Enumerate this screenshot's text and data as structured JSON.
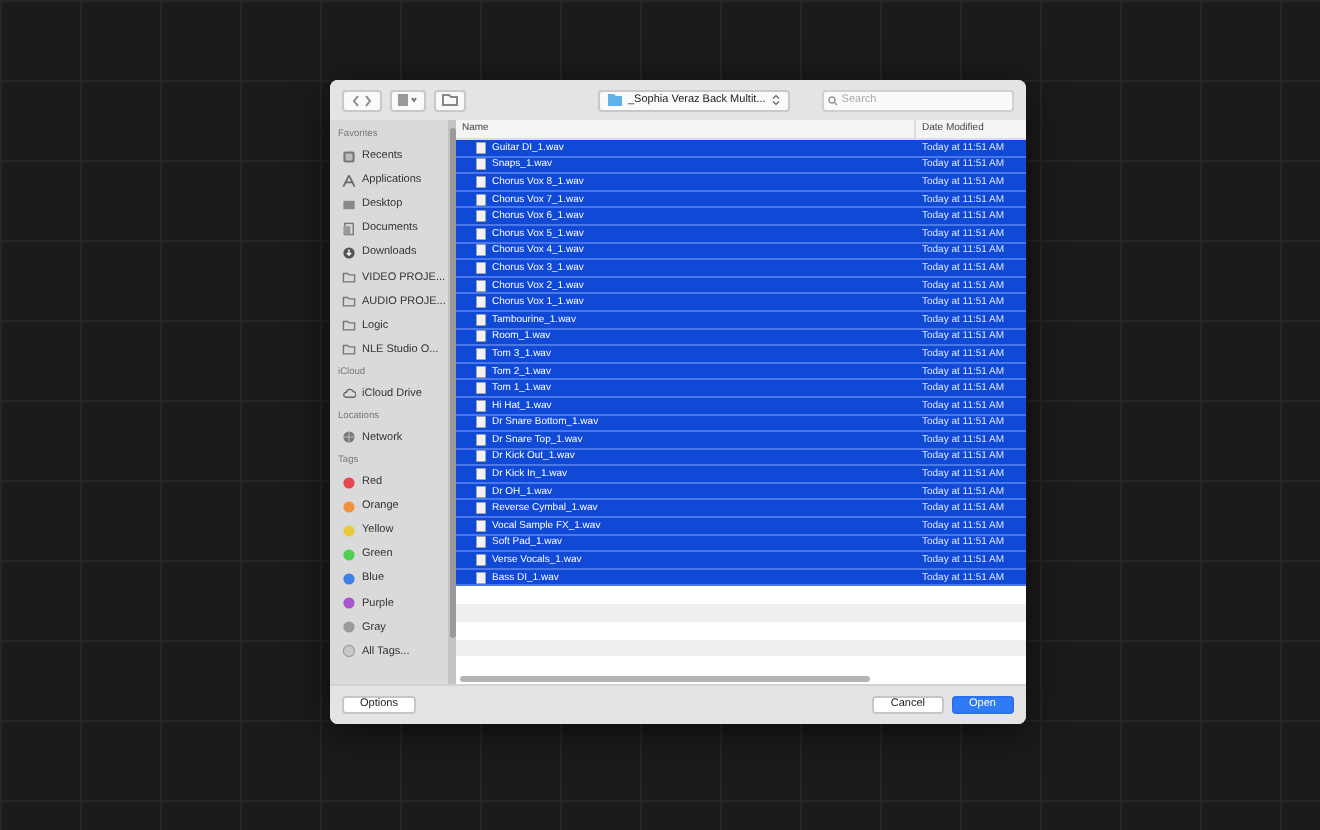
{
  "toolbar": {
    "path": "_Sophia Veraz Back Multit...",
    "search": {
      "placeholder": "Search"
    }
  },
  "sidebar": [
    {
      "heading": "Favorites",
      "items": [
        {
          "label": "Recents",
          "kind": "recents"
        },
        {
          "label": "Applications",
          "kind": "apps"
        },
        {
          "label": "Desktop",
          "kind": "desktop"
        },
        {
          "label": "Documents",
          "kind": "documents"
        },
        {
          "label": "Downloads",
          "kind": "downloads"
        },
        {
          "label": "VIDEO PROJE...",
          "kind": "folder"
        },
        {
          "label": "AUDIO PROJE...",
          "kind": "folder"
        },
        {
          "label": "Logic",
          "kind": "folder"
        },
        {
          "label": "NLE Studio O...",
          "kind": "folder"
        }
      ]
    },
    {
      "heading": "iCloud",
      "items": [
        {
          "label": "iCloud Drive",
          "kind": "cloud"
        }
      ]
    },
    {
      "heading": "Locations",
      "items": [
        {
          "label": "Network",
          "kind": "network"
        }
      ]
    },
    {
      "heading": "Tags",
      "items": [
        {
          "label": "Red",
          "kind": "tag",
          "color": "#e5484d"
        },
        {
          "label": "Orange",
          "kind": "tag",
          "color": "#f0943a"
        },
        {
          "label": "Yellow",
          "kind": "tag",
          "color": "#e8c93a"
        },
        {
          "label": "Green",
          "kind": "tag",
          "color": "#4fcf52"
        },
        {
          "label": "Blue",
          "kind": "tag",
          "color": "#3f7fe8"
        },
        {
          "label": "Purple",
          "kind": "tag",
          "color": "#a855d0"
        },
        {
          "label": "Gray",
          "kind": "tag",
          "color": "#9a9a9e"
        },
        {
          "label": "All Tags...",
          "kind": "alltags"
        }
      ]
    }
  ],
  "table": {
    "columns": [
      "Name",
      "Date Modified"
    ],
    "rows": [
      {
        "name": "Guitar DI_1.wav",
        "date": "Today at 11:51 AM",
        "selected": true
      },
      {
        "name": "Snaps_1.wav",
        "date": "Today at 11:51 AM",
        "selected": true
      },
      {
        "name": "Chorus Vox 8_1.wav",
        "date": "Today at 11:51 AM",
        "selected": true
      },
      {
        "name": "Chorus Vox 7_1.wav",
        "date": "Today at 11:51 AM",
        "selected": true
      },
      {
        "name": "Chorus Vox 6_1.wav",
        "date": "Today at 11:51 AM",
        "selected": true
      },
      {
        "name": "Chorus Vox 5_1.wav",
        "date": "Today at 11:51 AM",
        "selected": true
      },
      {
        "name": "Chorus Vox 4_1.wav",
        "date": "Today at 11:51 AM",
        "selected": true
      },
      {
        "name": "Chorus Vox 3_1.wav",
        "date": "Today at 11:51 AM",
        "selected": true
      },
      {
        "name": "Chorus Vox 2_1.wav",
        "date": "Today at 11:51 AM",
        "selected": true
      },
      {
        "name": "Chorus Vox 1_1.wav",
        "date": "Today at 11:51 AM",
        "selected": true
      },
      {
        "name": "Tambourine_1.wav",
        "date": "Today at 11:51 AM",
        "selected": true
      },
      {
        "name": "Room_1.wav",
        "date": "Today at 11:51 AM",
        "selected": true
      },
      {
        "name": "Tom 3_1.wav",
        "date": "Today at 11:51 AM",
        "selected": true
      },
      {
        "name": "Tom 2_1.wav",
        "date": "Today at 11:51 AM",
        "selected": true
      },
      {
        "name": "Tom 1_1.wav",
        "date": "Today at 11:51 AM",
        "selected": true
      },
      {
        "name": "Hi Hat_1.wav",
        "date": "Today at 11:51 AM",
        "selected": true
      },
      {
        "name": "Dr Snare Bottom_1.wav",
        "date": "Today at 11:51 AM",
        "selected": true
      },
      {
        "name": "Dr Snare Top_1.wav",
        "date": "Today at 11:51 AM",
        "selected": true
      },
      {
        "name": "Dr Kick Out_1.wav",
        "date": "Today at 11:51 AM",
        "selected": true
      },
      {
        "name": "Dr Kick In_1.wav",
        "date": "Today at 11:51 AM",
        "selected": true
      },
      {
        "name": "Dr OH_1.wav",
        "date": "Today at 11:51 AM",
        "selected": true
      },
      {
        "name": "Reverse Cymbal_1.wav",
        "date": "Today at 11:51 AM",
        "selected": true
      },
      {
        "name": "Vocal Sample FX_1.wav",
        "date": "Today at 11:51 AM",
        "selected": true
      },
      {
        "name": "Soft Pad_1.wav",
        "date": "Today at 11:51 AM",
        "selected": true
      },
      {
        "name": "Verse Vocals_1.wav",
        "date": "Today at 11:51 AM",
        "selected": true
      },
      {
        "name": "Bass DI_1.wav",
        "date": "Today at 11:51 AM",
        "selected": true
      }
    ]
  },
  "buttons": [
    {
      "label": "Options",
      "kind": "options"
    },
    {
      "label": "Cancel",
      "kind": "cancel"
    },
    {
      "label": "Open",
      "kind": "default"
    }
  ]
}
